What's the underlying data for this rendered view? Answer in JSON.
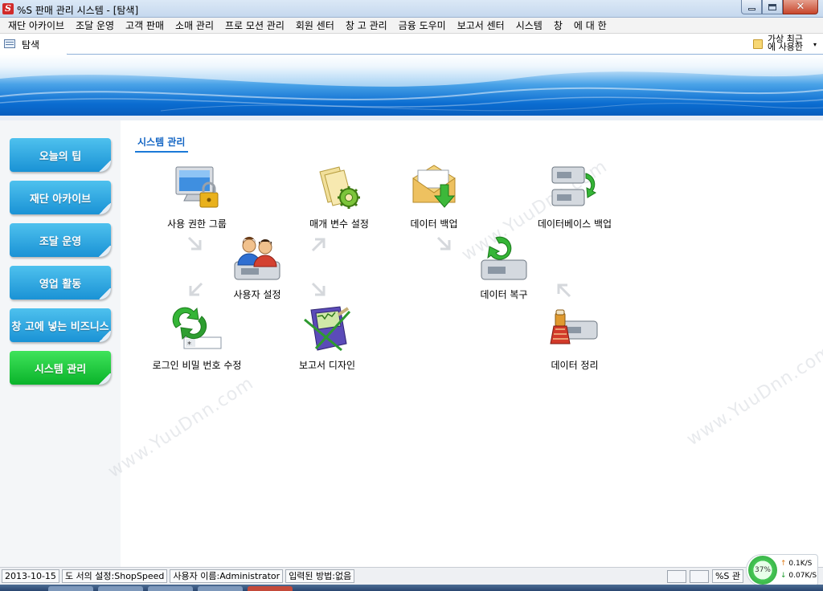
{
  "window": {
    "app_icon": "S",
    "title": "%S 판매 관리 시스템 - [탐색]",
    "controls": [
      "minimize-icon",
      "maximize-icon",
      "close-icon"
    ]
  },
  "menu": [
    "재단 아카이브",
    "조달 운영",
    "고객 판매",
    "소매 관리",
    "프로 모션 관리",
    "회원 센터",
    "창 고 관리",
    "금융 도우미",
    "보고서 센터",
    "시스템",
    "창",
    "에 대 한"
  ],
  "tab": {
    "label": "탐색",
    "icon": "navigation-icon"
  },
  "recent": {
    "label": "가상 최근 에 사용한",
    "icon": "folder-icon",
    "arrow": "▾"
  },
  "sidebar": [
    {
      "label": "오늘의 팁"
    },
    {
      "label": "재단 아카이브"
    },
    {
      "label": "조달 운영"
    },
    {
      "label": "영업 활동"
    },
    {
      "label": "창 고에 넣는 비즈니스"
    },
    {
      "label": "시스템 관리",
      "active": true
    }
  ],
  "main": {
    "section_title": "시스템 관리",
    "tiles": [
      {
        "label": "사용 권한 그룹",
        "icon": "monitor-lock-icon"
      },
      {
        "label": "매개 변수 설정",
        "icon": "documents-gear-icon"
      },
      {
        "label": "데이터 백업",
        "icon": "envelope-download-icon"
      },
      {
        "label": "데이터베이스 백업",
        "icon": "database-sync-icon"
      },
      {
        "label": "사용자 설정",
        "icon": "users-icon"
      },
      {
        "label": "데이터 복구",
        "icon": "database-restore-icon"
      },
      {
        "label": "로그인 비밀 번호 수정",
        "icon": "password-change-icon"
      },
      {
        "label": "보고서 디자인",
        "icon": "report-design-icon"
      },
      {
        "label": "데이터 정리",
        "icon": "database-cleanup-icon"
      }
    ]
  },
  "watermark": "www.YuuDnn.com",
  "status": {
    "date": "2013-10-15",
    "store": "도 서의 설정:ShopSpeed",
    "user": "사용자 이름:Administrator",
    "input": "입력된 방법:없음",
    "app": "%S 관"
  },
  "network": {
    "percent": "37%",
    "up": "0.1K/S",
    "down": "0.07K/S"
  },
  "colors": {
    "sidebar_button": "#1a92d5",
    "sidebar_active": "#0ab32a",
    "accent": "#1365c4"
  }
}
